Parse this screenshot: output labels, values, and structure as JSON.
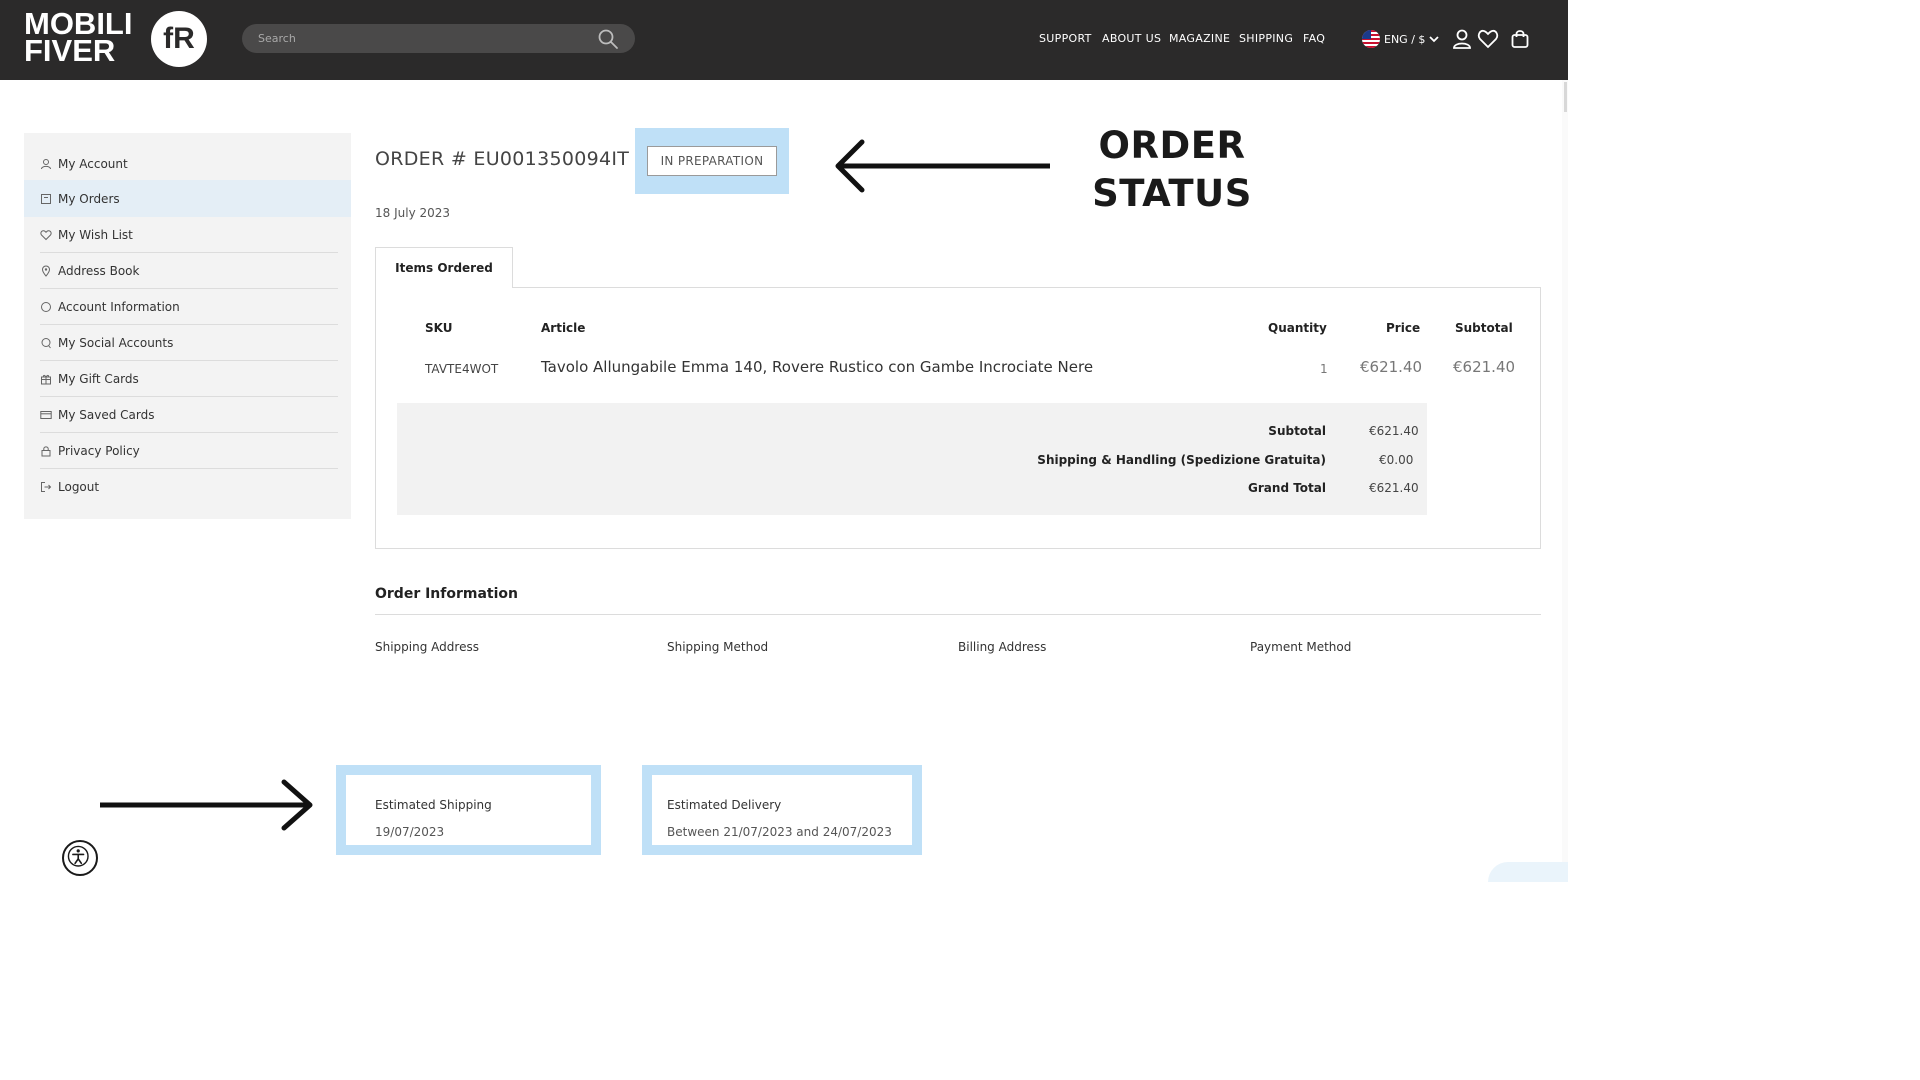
{
  "header": {
    "logo_line1": "MOBILI",
    "logo_line2": "FIVER",
    "logo_mark": "fR",
    "search_placeholder": "Search",
    "nav": [
      "SUPPORT",
      "ABOUT US",
      "MAGAZINE",
      "SHIPPING",
      "FAQ"
    ],
    "language": "ENG / $",
    "icons": [
      "search-icon",
      "flag-us-icon",
      "chevron-down-icon",
      "user-icon",
      "heart-icon",
      "bag-icon"
    ]
  },
  "sidebar": {
    "items": [
      {
        "label": "My Account",
        "icon": "user-icon"
      },
      {
        "label": "My Orders",
        "icon": "orders-icon",
        "active": true
      },
      {
        "label": "My Wish List",
        "icon": "heart-icon"
      },
      {
        "label": "Address Book",
        "icon": "location-pin-icon"
      },
      {
        "label": "Account Information",
        "icon": "circle-icon"
      },
      {
        "label": "My Social Accounts",
        "icon": "chat-icon"
      },
      {
        "label": "My Gift Cards",
        "icon": "gift-icon"
      },
      {
        "label": "My Saved Cards",
        "icon": "card-icon"
      },
      {
        "label": "Privacy Policy",
        "icon": "lock-icon"
      },
      {
        "label": "Logout",
        "icon": "logout-icon"
      }
    ]
  },
  "order": {
    "title": "ORDER # EU001350094IT",
    "status": "IN PREPARATION",
    "date": "18 July 2023",
    "tab": "Items Ordered",
    "columns": {
      "sku": "SKU",
      "article": "Article",
      "quantity": "Quantity",
      "price": "Price",
      "subtotal": "Subtotal"
    },
    "items": [
      {
        "sku": "TAVTE4WOT",
        "article": "Tavolo Allungabile Emma 140, Rovere Rustico con Gambe Incrociate Nere",
        "quantity": "1",
        "price": "€621.40",
        "subtotal": "€621.40"
      }
    ],
    "totals": [
      {
        "label": "Subtotal",
        "value": "€621.40"
      },
      {
        "label": "Shipping & Handling (Spedizione Gratuita)",
        "value": "€0.00"
      },
      {
        "label": "Grand Total",
        "value": "€621.40"
      }
    ]
  },
  "info": {
    "title": "Order Information",
    "columns": [
      "Shipping Address",
      "Shipping Method",
      "Billing Address",
      "Payment Method"
    ]
  },
  "estimates": {
    "shipping_label": "Estimated Shipping",
    "shipping_value": "19/07/2023",
    "delivery_label": "Estimated Delivery",
    "delivery_value": "Between 21/07/2023 and 24/07/2023"
  },
  "annotation": {
    "line1": "ORDER",
    "line2": "STATUS"
  },
  "colors": {
    "header_bg": "#2b2a2a",
    "highlight": "#bfe0f7",
    "active_item": "#e4eef6",
    "sidebar_bg": "#f3f3f3"
  }
}
